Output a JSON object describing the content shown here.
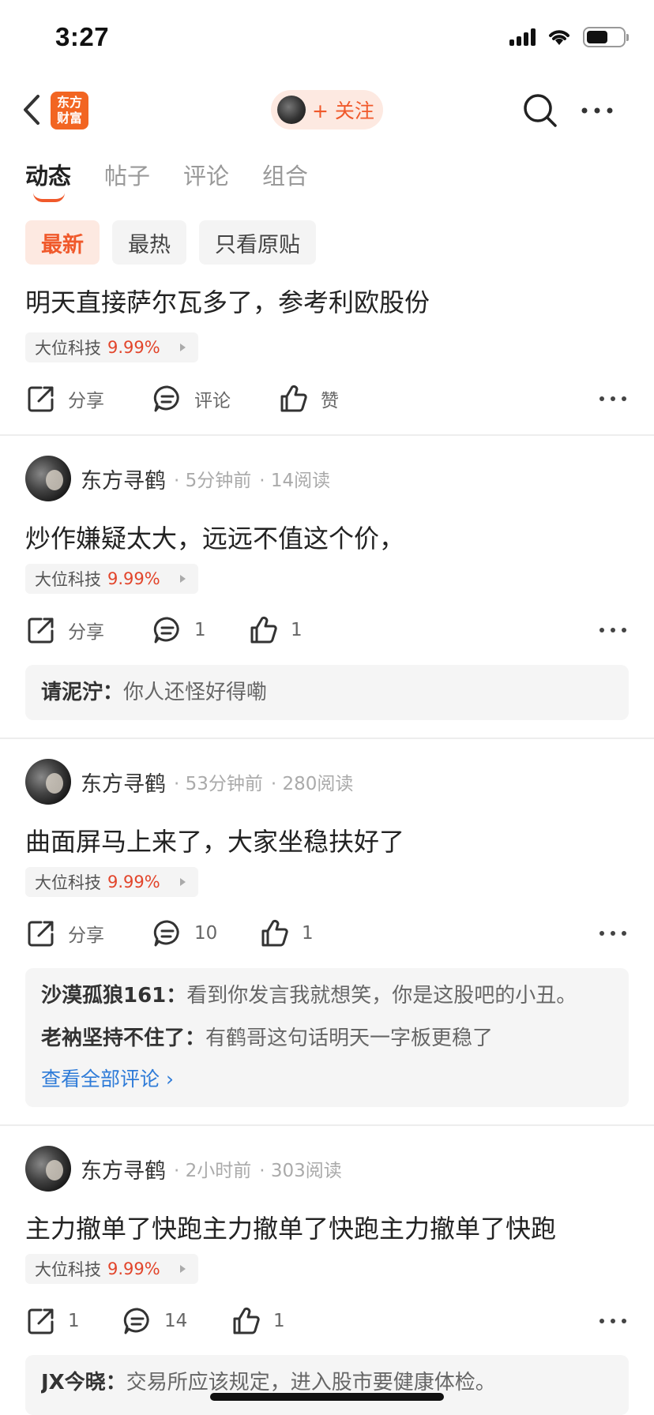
{
  "status": {
    "time": "3:27"
  },
  "nav": {
    "logo_line1": "东方",
    "logo_line2": "财富",
    "follow_label": "+ 关注"
  },
  "tabs": [
    "动态",
    "帖子",
    "评论",
    "组合"
  ],
  "filters": [
    "最新",
    "最热",
    "只看原贴"
  ],
  "posts": [
    {
      "text": "明天直接萨尔瓦多了，参考利欧股份",
      "stock": {
        "name": "大位科技",
        "pct": "9.99%"
      },
      "actions": {
        "share": "分享",
        "comment": "评论",
        "like": "赞"
      }
    },
    {
      "author": "东方寻鹤",
      "time": "· 5分钟前",
      "reads": "· 14阅读",
      "text": "炒作嫌疑太大，远远不值这个价，",
      "stock": {
        "name": "大位科技",
        "pct": "9.99%"
      },
      "actions": {
        "share": "分享",
        "comment": "1",
        "like": "1"
      },
      "comments": [
        {
          "user": "请泥泞：",
          "text": "你人还怪好得嘞"
        }
      ]
    },
    {
      "author": "东方寻鹤",
      "time": "· 53分钟前",
      "reads": "· 280阅读",
      "text": "曲面屏马上来了，大家坐稳扶好了",
      "stock": {
        "name": "大位科技",
        "pct": "9.99%"
      },
      "actions": {
        "share": "分享",
        "comment": "10",
        "like": "1"
      },
      "comments": [
        {
          "user": "沙漠孤狼161：",
          "text": "看到你发言我就想笑，你是这股吧的小丑。"
        },
        {
          "user": "老衲坚持不住了：",
          "text": "有鹤哥这句话明天一字板更稳了"
        }
      ],
      "view_all": "查看全部评论 ›"
    },
    {
      "author": "东方寻鹤",
      "time": "· 2小时前",
      "reads": "· 303阅读",
      "text": "主力撤单了快跑主力撤单了快跑主力撤单了快跑",
      "stock": {
        "name": "大位科技",
        "pct": "9.99%"
      },
      "actions": {
        "share": "1",
        "comment": "14",
        "like": "1"
      },
      "comments": [
        {
          "user": "JX今晓：",
          "text": "交易所应该规定，进入股市要健康体检。"
        }
      ]
    }
  ]
}
